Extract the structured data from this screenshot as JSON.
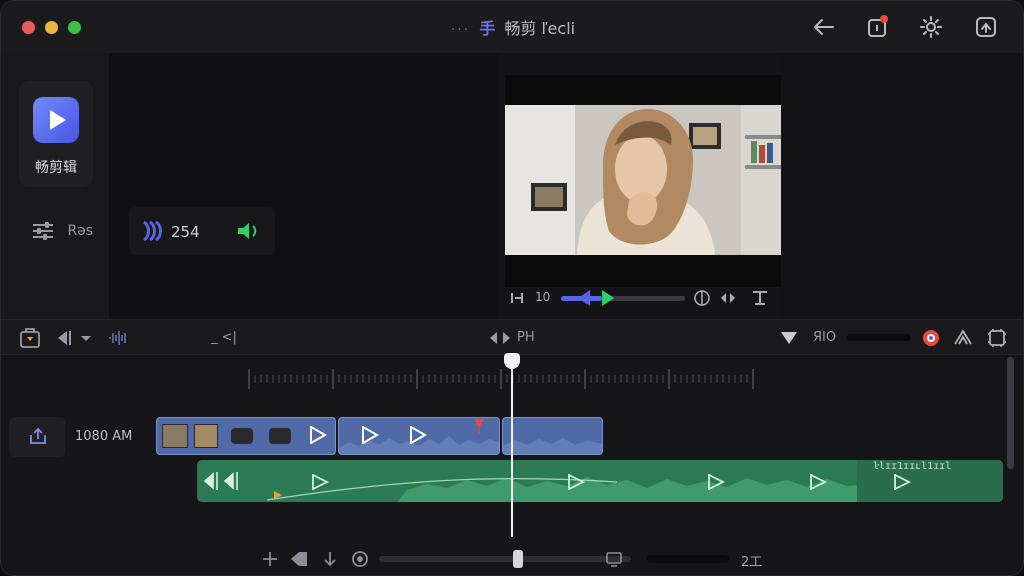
{
  "titlebar": {
    "title_dots": "···",
    "title_mark": "手",
    "title_text": "畅剪 ľecli"
  },
  "sidebar": {
    "app_name": "畅剪辑",
    "settings_label": "Rəs"
  },
  "panel": {
    "stat_value": "254"
  },
  "preview": {
    "time_value": "10",
    "progress": 0.38
  },
  "toolbar": {
    "left_text": "_ <|",
    "center_label": "PH",
    "right_label": "ЯIO"
  },
  "timeline": {
    "track_label": "1080 AM",
    "audio_label": "ŀlɪɪ1ɪɪʟl1ɪɪl"
  },
  "bottombar": {
    "zoom_label": "2工"
  },
  "colors": {
    "accent": "#5a63e8",
    "video_clip": "#4f6aa6",
    "audio_clip": "#2c7a55",
    "marker": "#e84a3a",
    "green_play": "#2fcf6a"
  }
}
